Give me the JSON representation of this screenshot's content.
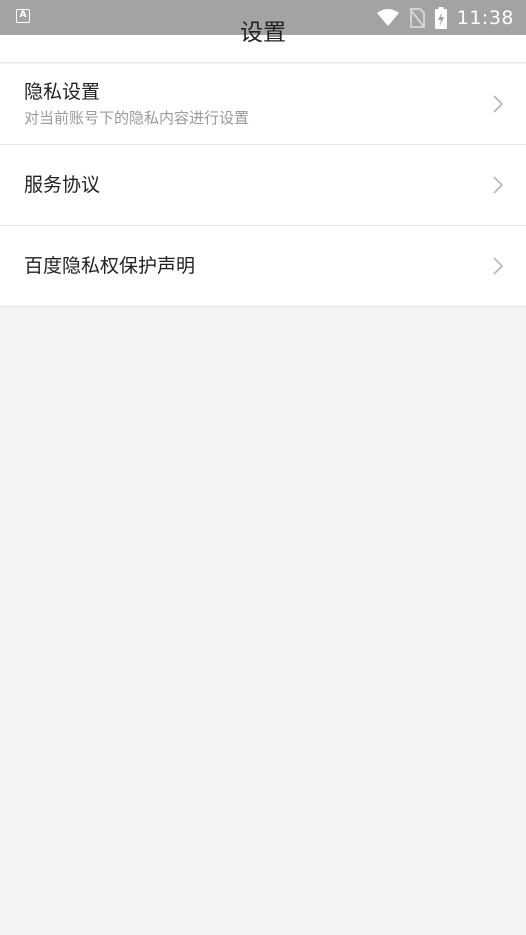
{
  "status_bar": {
    "left_icon": "A",
    "time": "11:38",
    "icons": [
      "wifi-icon",
      "no-sim-icon",
      "battery-charging-icon"
    ]
  },
  "header": {
    "title": "设置"
  },
  "settings": {
    "items": [
      {
        "title": "隐私设置",
        "subtitle": "对当前账号下的隐私内容进行设置",
        "icon": "chevron-right-icon"
      },
      {
        "title": "服务协议",
        "icon": "chevron-right-icon"
      },
      {
        "title": "百度隐私权保护声明",
        "icon": "chevron-right-icon"
      }
    ]
  },
  "colors": {
    "status_bar": "#a3a3a3",
    "background": "#f4f4f4",
    "list_background": "#ffffff",
    "divider": "#e6e6e6",
    "primary_text": "#222222",
    "secondary_text": "#9a9a9a"
  }
}
